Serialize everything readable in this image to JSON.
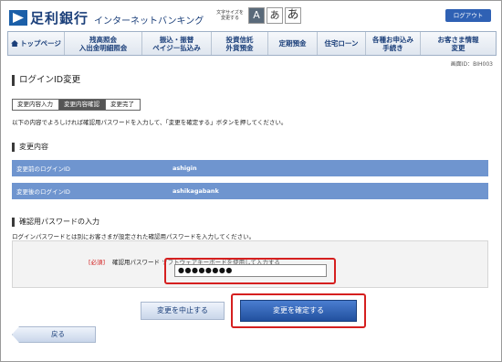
{
  "header": {
    "bank_name": "足利銀行",
    "service_name": "インターネットバンキング",
    "fontsize_label": "文字サイズを変更する",
    "fontsize_buttons": [
      "A",
      "あ",
      "あ"
    ],
    "logout": "ログアウト"
  },
  "nav": [
    {
      "label": "トップページ"
    },
    {
      "label": "残高照会",
      "sub": "入出金明細照会"
    },
    {
      "label": "振込・振替",
      "sub": "ペイジー払込み"
    },
    {
      "label": "投資信託",
      "sub": "外貨預金"
    },
    {
      "label": "定期預金"
    },
    {
      "label": "住宅ローン"
    },
    {
      "label": "各種お申込み",
      "sub": "手続き"
    },
    {
      "label": "お客さま情報",
      "sub": "変更"
    }
  ],
  "screen_id": "画面ID：BIH003",
  "page_title": "ログインID変更",
  "steps": [
    "変更内容入力",
    "変更内容確認",
    "変更完了"
  ],
  "instruction": "以下の内容でよろしければ確認用パスワードを入力して、「変更を確定する」ボタンを押してください。",
  "changes": {
    "title": "変更内容",
    "rows": [
      {
        "label": "変更前のログインID",
        "value": "ashigin"
      },
      {
        "label": "変更後のログインID",
        "value": "ashikagabank"
      }
    ]
  },
  "password": {
    "title": "確認用パスワードの入力",
    "note": "ログインパスワードとは別にお客さまが設定された確認用パスワードを入力してください。",
    "required": "[必須]",
    "label": "確認用パスワード",
    "keyboard_note": "ソフトウェアキーボードを使用して入力する",
    "value": "●●●●●●●●"
  },
  "buttons": {
    "cancel": "変更を中止する",
    "confirm": "変更を確定する",
    "back": "戻る"
  },
  "colors": {
    "brand": "#1b3f7a",
    "highlight": "#d51f1f",
    "row_dark": "#6f95cf",
    "row_light": "#bfd3ee"
  }
}
